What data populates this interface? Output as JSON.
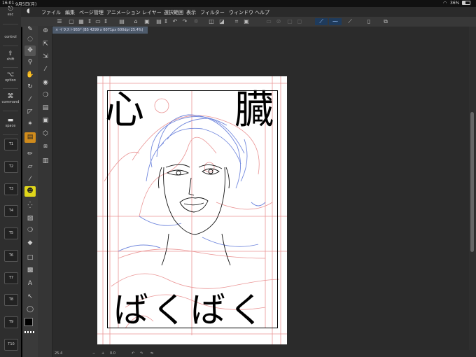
{
  "status_bar": {
    "time": "16:01",
    "date": "9月5日(月)",
    "battery": "36%"
  },
  "menu": [
    "ファイル",
    "編集",
    "ページ管理",
    "アニメーション",
    "レイヤー",
    "選択範囲",
    "表示",
    "フィルター",
    "ウィンドウ",
    "ヘルプ"
  ],
  "modifier_keys": [
    {
      "label": "esc",
      "glyph": "⎋"
    },
    {
      "label": "control",
      "glyph": ""
    },
    {
      "label": "shift",
      "glyph": "⇧"
    },
    {
      "label": "option",
      "glyph": "⌥"
    },
    {
      "label": "command",
      "glyph": "⌘"
    },
    {
      "label": "space",
      "glyph": "▬"
    }
  ],
  "touch_keys": [
    "T1",
    "T2",
    "T3",
    "T4",
    "T5",
    "T6",
    "T7",
    "T8",
    "T9",
    "T10"
  ],
  "document_tab": "× イラスト955* (B5 4299 x 6071px 600dpi 25.4%)",
  "artwork_text": {
    "left_kanji": "心",
    "right_kanji": "臓",
    "bottom": "ばくばく"
  },
  "bottom_status": {
    "zoom": "25.4",
    "angle": "0.0"
  },
  "colors": {
    "accent": "#4e5b6c",
    "main_color": "#000000",
    "sub_color": "#ffffff"
  }
}
